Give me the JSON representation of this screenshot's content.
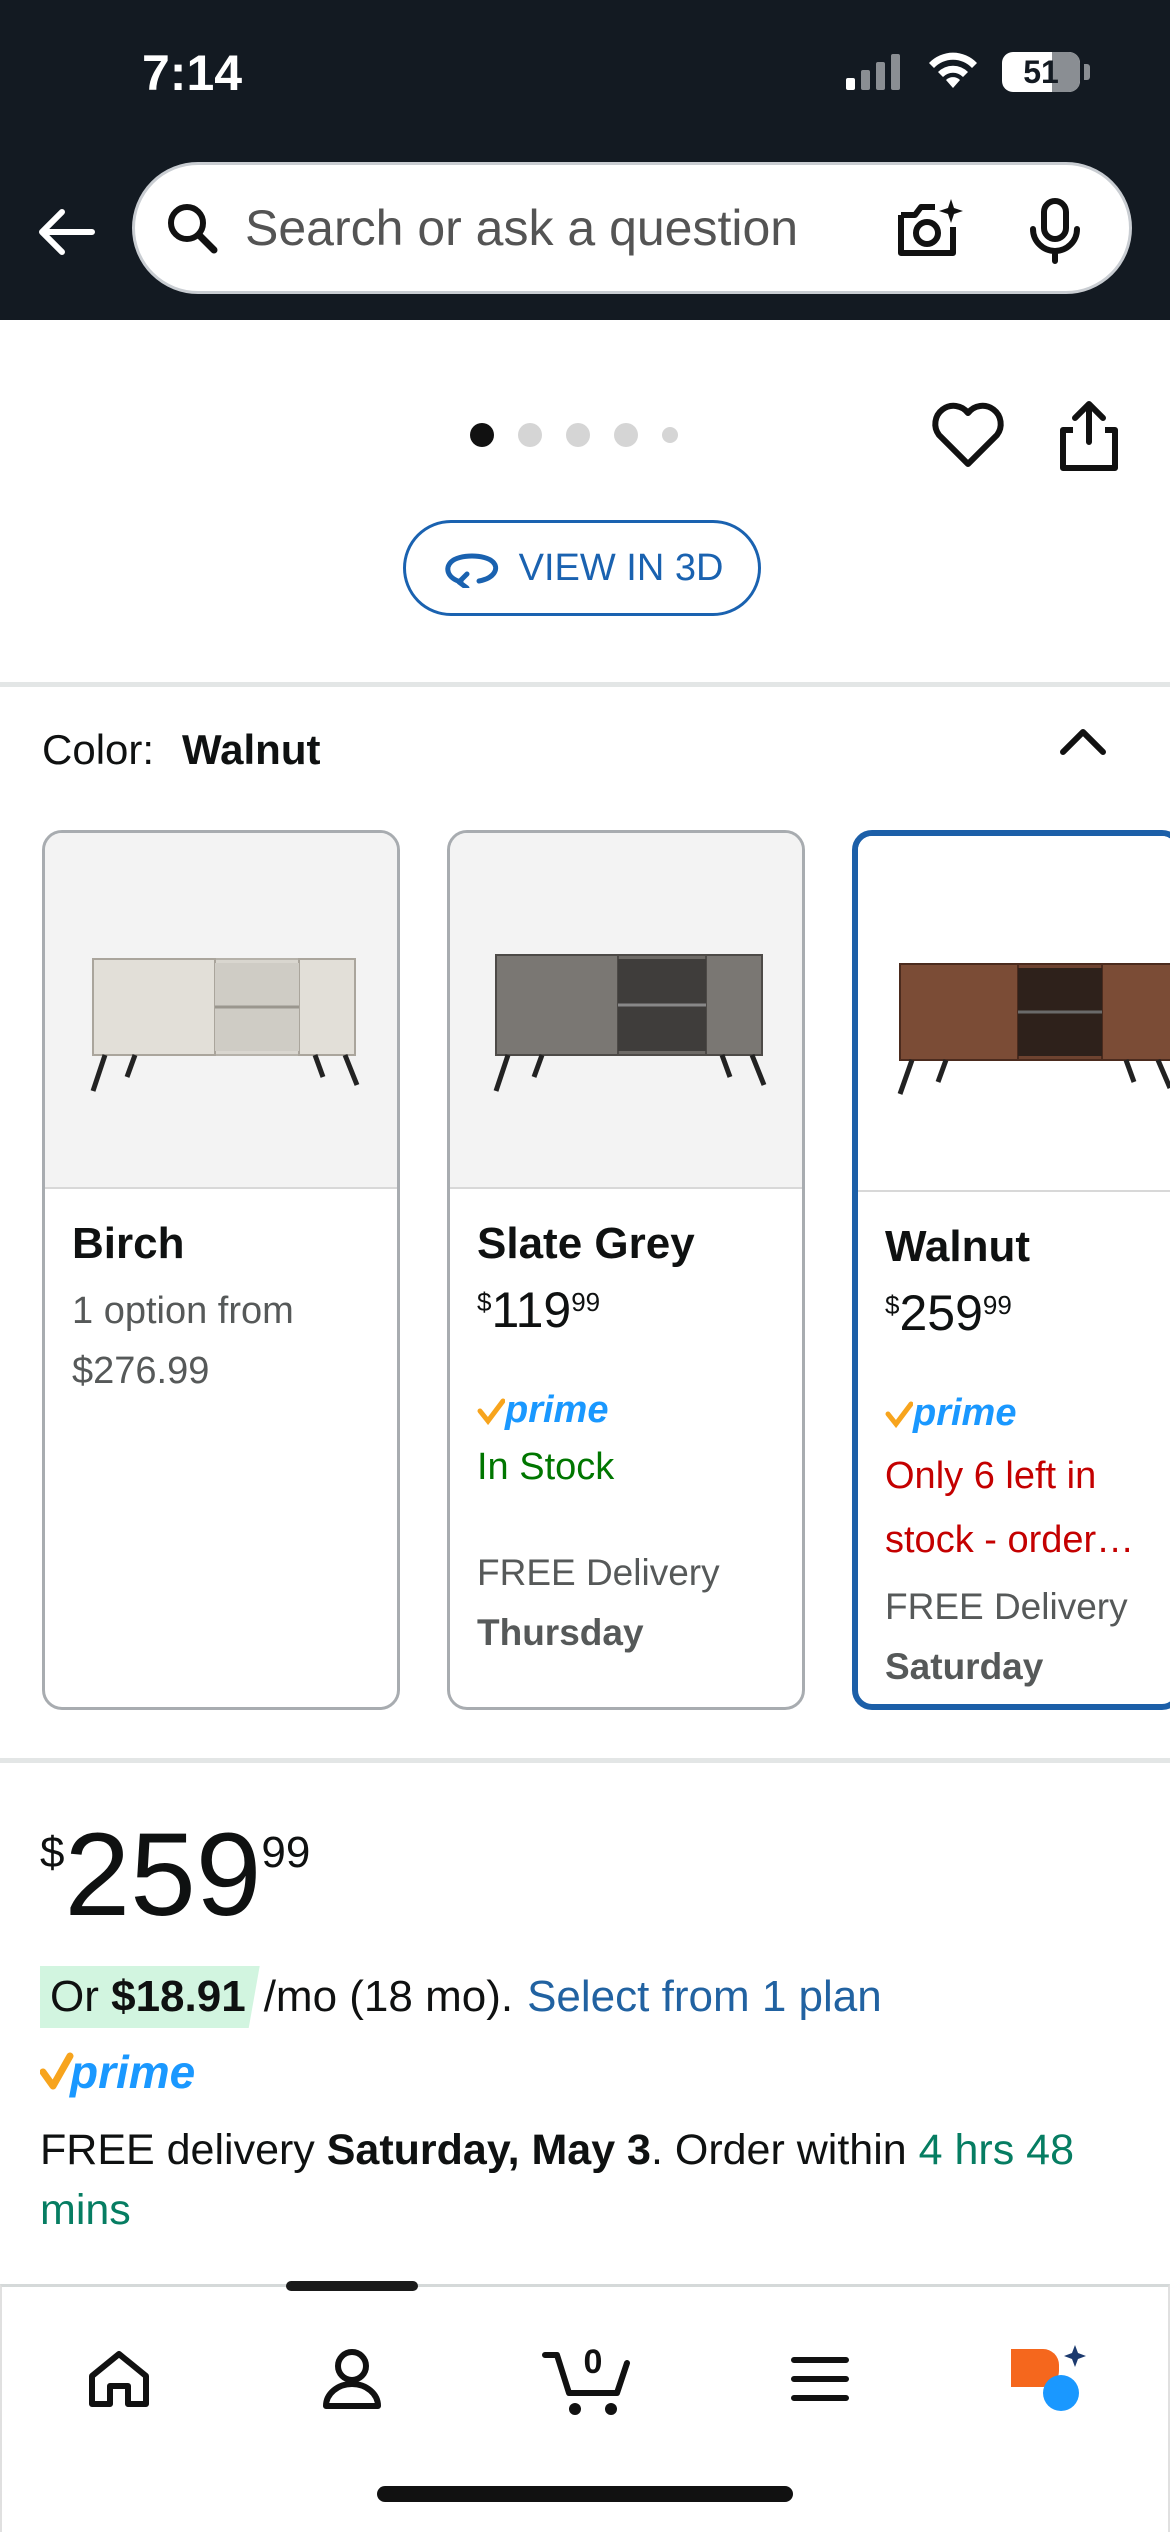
{
  "status_bar": {
    "time": "7:14",
    "battery": "51"
  },
  "search": {
    "placeholder": "Search or ask a question"
  },
  "gallery": {
    "dot_count": 5,
    "active_dot": 0,
    "view_3d_label": "VIEW IN 3D"
  },
  "color_selector": {
    "label": "Color:",
    "selected": "Walnut",
    "options": [
      {
        "name": "Birch",
        "line1": "1 option from",
        "line2": "$276.99"
      },
      {
        "name": "Slate Grey",
        "price_symbol": "$",
        "price_whole": "119",
        "price_cents": "99",
        "prime": "prime",
        "stock": "In Stock",
        "delivery": "FREE Delivery",
        "delivery_day": "Thursday"
      },
      {
        "name": "Walnut",
        "price_symbol": "$",
        "price_whole": "259",
        "price_cents": "99",
        "prime": "prime",
        "stock_line1": "Only 6 left in",
        "stock_line2": "stock - order…",
        "delivery": "FREE Delivery",
        "delivery_day": "Saturday"
      }
    ]
  },
  "price": {
    "symbol": "$",
    "whole": "259",
    "cents": "99"
  },
  "financing": {
    "chip_prefix": "Or ",
    "monthly": "$18.91",
    "term": "/mo (18 mo).",
    "link": "Select from 1 plan"
  },
  "prime_badge": "prime",
  "delivery": {
    "prefix": "FREE delivery ",
    "date": "Saturday, May 3",
    "middle": ". Order within ",
    "countdown": "4 hrs 48 mins"
  },
  "cart_count": "0",
  "colors": {
    "header": "#131a22",
    "link": "#2162a1",
    "prime_blue": "#1a98ff",
    "prime_check": "#f7a41d",
    "in_stock": "#007600",
    "low_stock": "#c40000",
    "selected_border": "#1c5fa8"
  }
}
